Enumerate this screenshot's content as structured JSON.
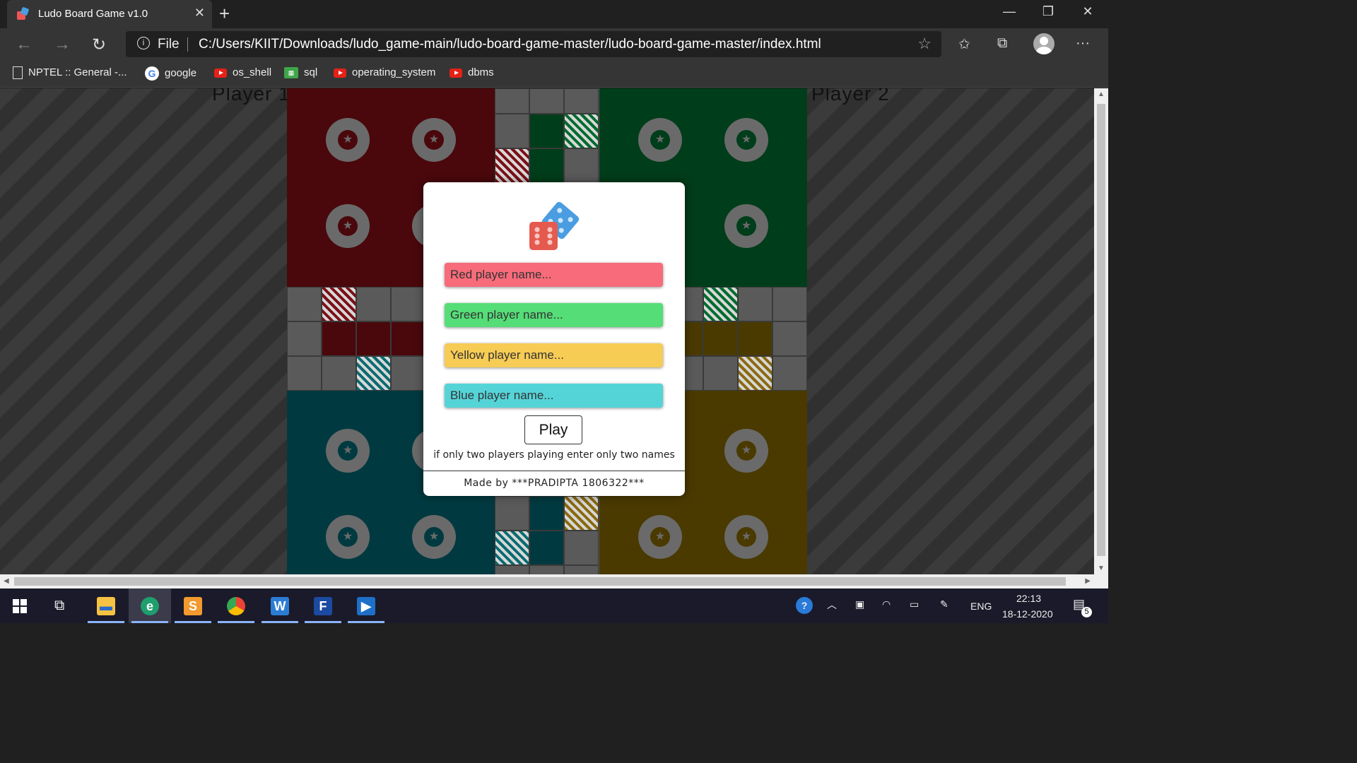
{
  "browser": {
    "tab_title": "Ludo Board Game v1.0",
    "close_tab": "✕",
    "new_tab": "+",
    "address_label": "File",
    "url": "C:/Users/KIIT/Downloads/ludo_game-main/ludo-board-game-master/ludo-board-game-master/index.html",
    "bookmarks": [
      "NPTEL :: General -...",
      "google",
      "os_shell",
      "sql",
      "operating_system",
      "dbms"
    ]
  },
  "page": {
    "player1_label": "Player 1",
    "player2_label": "Player 2",
    "modal": {
      "red_placeholder": "Red player name...",
      "green_placeholder": "Green player name...",
      "yellow_placeholder": "Yellow player name...",
      "blue_placeholder": "Blue player name...",
      "play_label": "Play",
      "hint": "if only two players playing enter only two names",
      "credit": "Made by ***PRADIPTA 1806322***"
    }
  },
  "colors": {
    "red_home": "#4a080c",
    "green_home": "#003d1a",
    "teal_home": "#003a40",
    "yellow_home": "#4a3a00",
    "red_input": "#f76b7a",
    "green_input": "#55dd77",
    "yellow_input": "#f7cc55",
    "blue_input": "#55d4d8"
  },
  "taskbar": {
    "language": "ENG",
    "time": "22:13",
    "date": "18-12-2020",
    "notifications": "5"
  }
}
